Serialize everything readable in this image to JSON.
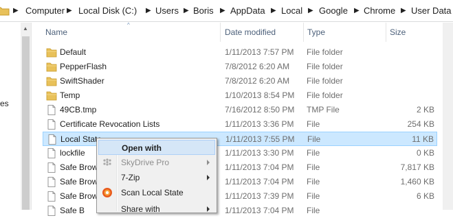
{
  "breadcrumb": [
    "Computer",
    "Local Disk (C:)",
    "Users",
    "Boris",
    "AppData",
    "Local",
    "Google",
    "Chrome",
    "User Data"
  ],
  "nav_pane": {
    "partial_label": "es"
  },
  "columns": {
    "name": "Name",
    "date": "Date modified",
    "type": "Type",
    "size": "Size"
  },
  "files": [
    {
      "name": "Default",
      "date": "1/11/2013 7:57 PM",
      "type": "File folder",
      "size": "",
      "kind": "folder"
    },
    {
      "name": "PepperFlash",
      "date": "7/8/2012 6:20 AM",
      "type": "File folder",
      "size": "",
      "kind": "folder"
    },
    {
      "name": "SwiftShader",
      "date": "7/8/2012 6:20 AM",
      "type": "File folder",
      "size": "",
      "kind": "folder"
    },
    {
      "name": "Temp",
      "date": "1/10/2013 8:54 PM",
      "type": "File folder",
      "size": "",
      "kind": "folder"
    },
    {
      "name": "49CB.tmp",
      "date": "7/16/2012 8:50 PM",
      "type": "TMP File",
      "size": "2 KB",
      "kind": "file"
    },
    {
      "name": "Certificate Revocation Lists",
      "date": "1/11/2013 3:36 PM",
      "type": "File",
      "size": "254 KB",
      "kind": "file"
    },
    {
      "name": "Local State",
      "date": "1/11/2013 7:55 PM",
      "type": "File",
      "size": "11 KB",
      "kind": "file",
      "selected": true
    },
    {
      "name": "lockfile",
      "date": "1/11/2013 3:30 PM",
      "type": "File",
      "size": "0 KB",
      "kind": "file"
    },
    {
      "name": "Safe Brows",
      "date": "1/11/2013 7:04 PM",
      "type": "File",
      "size": "7,817 KB",
      "kind": "file"
    },
    {
      "name": "Safe Brows",
      "date": "1/11/2013 7:04 PM",
      "type": "File",
      "size": "1,460 KB",
      "kind": "file"
    },
    {
      "name": "Safe Brows",
      "date": "1/11/2013 7:39 PM",
      "type": "File",
      "size": "6 KB",
      "kind": "file"
    },
    {
      "name": "Safe B",
      "date": "1/11/2013 7:04 PM",
      "type": "File",
      "size": "",
      "kind": "file"
    }
  ],
  "context_menu": [
    {
      "label": "Open with",
      "bold": true,
      "highlighted": true,
      "disabled": false,
      "submenu": false,
      "icon": ""
    },
    {
      "label": "SkyDrive Pro",
      "bold": false,
      "highlighted": false,
      "disabled": true,
      "submenu": true,
      "icon": "skydrive-icon"
    },
    {
      "label": "7-Zip",
      "bold": false,
      "highlighted": false,
      "disabled": false,
      "submenu": true,
      "icon": ""
    },
    {
      "label": "Scan Local State",
      "bold": false,
      "highlighted": false,
      "disabled": false,
      "submenu": false,
      "icon": "antivirus-scan-icon"
    },
    {
      "label": "Share with",
      "bold": false,
      "highlighted": false,
      "disabled": false,
      "submenu": true,
      "icon": ""
    }
  ],
  "colors": {
    "selection": "#cce8ff",
    "selection_border": "#99d1ff",
    "header_text": "#4c607a",
    "folder": "#e8c15a"
  }
}
